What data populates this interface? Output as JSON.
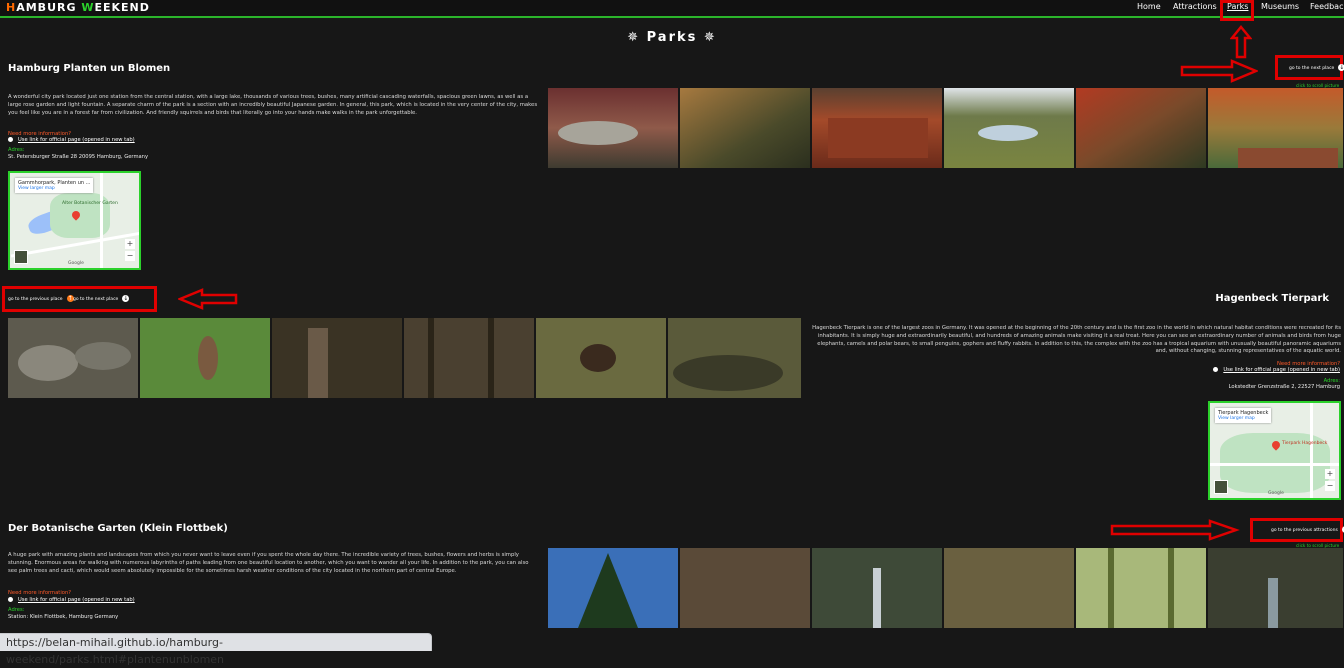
{
  "header": {
    "logo_h": "H",
    "logo_amburg": "AMBURG ",
    "logo_w": "W",
    "logo_eekend": "EEKEND",
    "nav": [
      "Home",
      "Attractions",
      "Parks",
      "Museums",
      "Feedback"
    ]
  },
  "page_title": "✵ Parks ✵",
  "sections": [
    {
      "title": "Hamburg Planten un Blomen",
      "description": "A wonderful city park located just one station from the central station, with a large lake, thousands of various trees, bushes, many artificial cascading waterfalls, spacious green lawns, as well as a large rose garden and light fountain. A separate charm of the park is a section with an incredibly beautiful Japanese garden. In general, this park, which is located in the very center of the city, makes you feel like you are in a forest far from civilization. And friendly squirrels and birds that literally go into your hands make walks in the park unforgettable.",
      "need_info": "Need more information?",
      "link": "Use link for official page (opened in new tab)",
      "address_label": "Adres:",
      "address": "St. Petersburger Straße 28 20095 Hamburg, Germany",
      "map_title": "Gammhorpark, Planten un ...",
      "map_link": "View larger map",
      "btn_next": "go to the next place",
      "click_hint": "click to scroll picture"
    },
    {
      "title": "Hagenbeck Tierpark",
      "description": "Hagenbeck Tierpark is one of the largest zoos in Germany. It was opened at the beginning of the 20th century and is the first zoo in the world in which natural habitat conditions were recreated for its inhabitants. It is simply huge and extraordinarily beautiful, and hundreds of amazing animals make visiting it a real treat. Here you can see an extraordinary number of animals and birds from huge elephants, camels and polar bears, to small penguins, gophers and fluffy rabbits. In addition to this, the complex with the zoo has a tropical aquarium with unusually beautiful panoramic aquariums and, without changing, stunning representatives of the aquatic world.",
      "need_info": "Need more information?",
      "link": "Use link for official page (opened in new tab)",
      "address_label": "Adres:",
      "address": "Lokstedter Grenzstraße 2, 22527 Hamburg",
      "map_title": "Tierpark Hagenbeck",
      "map_link": "View larger map",
      "btn_prev": "go to the previous place",
      "btn_next": "go to the next place"
    },
    {
      "title": "Der Botanische Garten (Klein Flottbek)",
      "description": "A huge park with amazing plants and landscapes from which you never want to leave even if you spent the whole day there. The incredible variety of trees, bushes, flowers and herbs is simply stunning. Enormous areas for walking with numerous labyrinths of paths leading from one beautiful location to another, which you want to wander all your life. In addition to the park, you can also see palm trees and cacti, which would seem absolutely impossible for the sometimes harsh weather conditions of the city located in the northern part of central Europe.",
      "need_info": "Need more information?",
      "link": "Use link for official page (opened in new tab)",
      "address_label": "Adres:",
      "address": "Station: Klein Flottbek, Hamburg Germany",
      "btn_prev_attr": "go to the previous attractions",
      "click_hint": "click to scroll picture"
    }
  ],
  "status_url": "https://belan-mihail.github.io/hamburg-weekend/parks.html#plantenunblomen",
  "colors": {
    "accent_green": "#2bd12b",
    "accent_orange": "#ff6a00",
    "annotation_red": "#e00000",
    "background": "#171717"
  }
}
